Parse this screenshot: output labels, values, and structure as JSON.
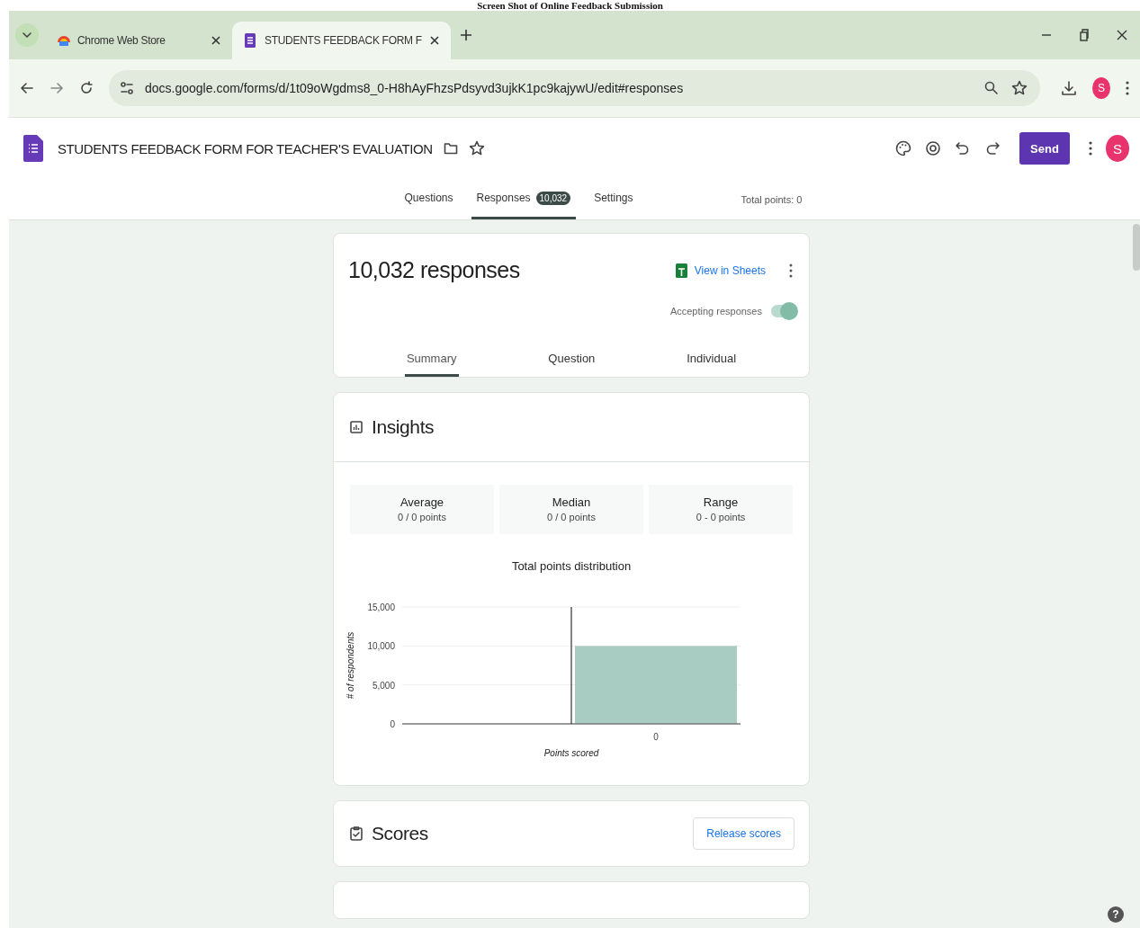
{
  "caption": "Screen Shot of Online Feedback Submission",
  "browser": {
    "tabs": [
      {
        "title": "Chrome Web Store",
        "selected": false,
        "kind": "store"
      },
      {
        "title": "STUDENTS FEEDBACK FORM F",
        "selected": true,
        "kind": "forms"
      }
    ],
    "url": "docs.google.com/forms/d/1t09oWgdms8_0-H8hAyFhzsPdsyvd3ujkK1pc9kajywU/edit#responses",
    "avatar": "S"
  },
  "form": {
    "title": "STUDENTS FEEDBACK FORM FOR TEACHER'S EVALUATION",
    "send": "Send",
    "avatar": "S",
    "tabs": [
      {
        "label": "Questions",
        "selected": false
      },
      {
        "label": "Responses",
        "selected": true,
        "badge": "10,032"
      },
      {
        "label": "Settings",
        "selected": false
      }
    ],
    "total_points": "Total points: 0"
  },
  "responses": {
    "count": "10,032 responses",
    "sheets_link": "View in Sheets",
    "accepting": {
      "label": "Accepting responses",
      "on": true
    },
    "views": [
      {
        "label": "Summary",
        "selected": true
      },
      {
        "label": "Question",
        "selected": false
      },
      {
        "label": "Individual",
        "selected": false
      }
    ]
  },
  "insights": {
    "title": "Insights",
    "stats": [
      {
        "label": "Average",
        "value": "0 / 0 points"
      },
      {
        "label": "Median",
        "value": "0 / 0 points"
      },
      {
        "label": "Range",
        "value": "0 - 0 points"
      }
    ],
    "chart_data": {
      "type": "bar",
      "title": "Total points distribution",
      "xlabel": "Points scored",
      "ylabel": "# of respondents",
      "categories": [
        "0"
      ],
      "values": [
        10000
      ],
      "ylim": [
        0,
        15000
      ],
      "yticks": [
        {
          "value": 0,
          "label": "0"
        },
        {
          "value": 5000,
          "label": "5,000"
        },
        {
          "value": 10000,
          "label": "10,000"
        },
        {
          "value": 15000,
          "label": "15,000"
        }
      ]
    }
  },
  "scores": {
    "title": "Scores",
    "button": "Release scores"
  },
  "help": "?"
}
